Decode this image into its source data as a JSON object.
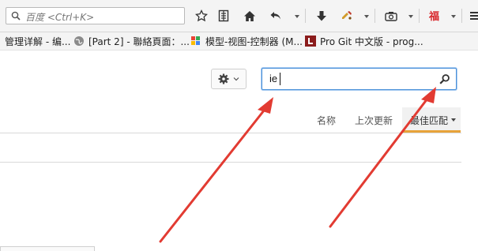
{
  "toolbar": {
    "search_placeholder": "百度 <Ctrl+K>",
    "icons": [
      "search-icon",
      "star-icon",
      "reading-list-icon",
      "home-icon",
      "back-icon",
      "download-icon",
      "extension-icon",
      "screenshot-icon",
      "addon-icon",
      "menu-icon"
    ]
  },
  "bookmarks": [
    {
      "label": "管理详解 - 编...",
      "icon": "none"
    },
    {
      "label": "[Part 2] - 聯絡頁面：...",
      "icon": "globe-icon"
    },
    {
      "label": "模型-视图-控制器 (M...",
      "icon": "colorful-tiles-icon"
    },
    {
      "label": "Pro Git 中文版 - prog...",
      "icon": "red-l-icon"
    }
  ],
  "page": {
    "addon_search_value": "ie",
    "sort": {
      "name": "名称",
      "last_updated": "上次更新",
      "best_match": "最佳匹配"
    }
  },
  "colors": {
    "accent_orange": "#e8a33a",
    "focus_blue": "#4a90d9",
    "arrow_red": "#e23b32"
  }
}
